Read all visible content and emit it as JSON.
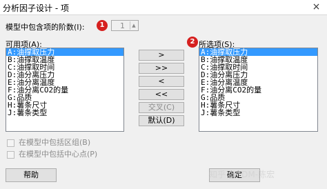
{
  "window": {
    "title": "分析因子设计 - 项",
    "close_glyph": "×"
  },
  "model": {
    "order_label": "模型中包含项的阶数(I):",
    "order_value": "1",
    "badge_1": "1",
    "badge_2": "2"
  },
  "available": {
    "label": "可用项(A):",
    "items": [
      "A:油撑取压力",
      "B:油撑取温度",
      "C:油撑取时间",
      "D:油分离压力",
      "E:油分离温度",
      "F:油分离CO2的量",
      "G:品质",
      "H:薯条尺寸",
      "J:薯条类型"
    ]
  },
  "selected": {
    "label": "所选项(S):",
    "items": [
      "A:油撑取压力",
      "B:油撑取温度",
      "C:油撑取时间",
      "D:油分离压力",
      "E:油分离温度",
      "F:油分离CO2的量",
      "G:品质",
      "H:薯条尺寸",
      "J:薯条类型"
    ]
  },
  "buttons": {
    "add_one": ">",
    "add_all": ">>",
    "remove_one": "<",
    "remove_all": "<<",
    "cross": "交叉(C)",
    "default": "默认(D)",
    "help": "帮助",
    "ok": "确定"
  },
  "options": {
    "include_blocks": "在模型中包括区组(B)",
    "include_center": "在模型中包括中心点(P)"
  },
  "watermark": "知乎 @TDM-陈宏"
}
